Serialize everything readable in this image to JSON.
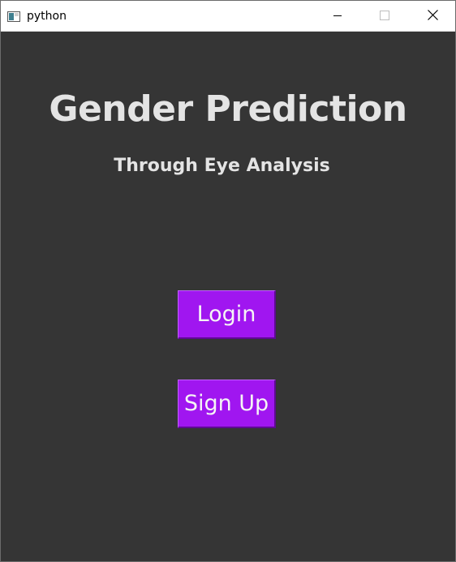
{
  "window": {
    "title": "python",
    "icon": "tk-window-icon",
    "controls": {
      "minimize_icon": "minimize-icon",
      "maximize_icon": "maximize-icon",
      "close_icon": "close-icon"
    }
  },
  "main": {
    "title": "Gender Prediction",
    "subtitle": "Through Eye Analysis",
    "login_label": "Login",
    "signup_label": "Sign Up"
  },
  "colors": {
    "background": "#353535",
    "button": "#a016f0",
    "heading_text": "#e4e4e4"
  }
}
